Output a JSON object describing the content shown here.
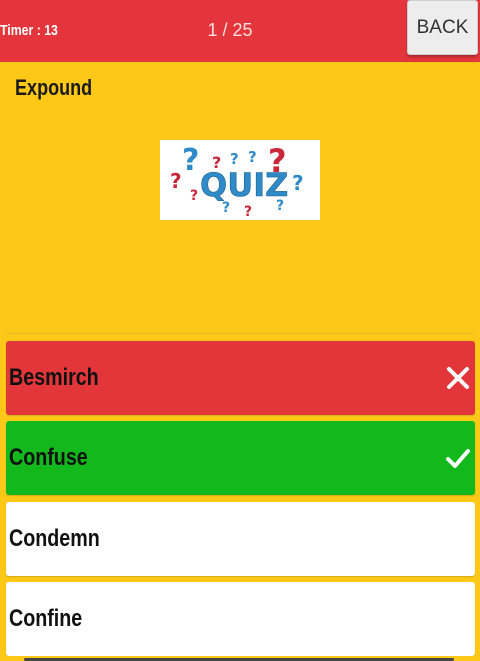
{
  "header": {
    "timer": "Timer  : 13",
    "progress": "1 / 25",
    "back_label": "BACK"
  },
  "question": {
    "word": "Expound",
    "image_text": "QUIZ"
  },
  "options": [
    {
      "label": "Besmirch",
      "state": "wrong",
      "icon": "close-icon"
    },
    {
      "label": "Confuse",
      "state": "correct",
      "icon": "check-icon"
    },
    {
      "label": "Condemn",
      "state": "neutral"
    },
    {
      "label": "Confine",
      "state": "neutral"
    }
  ],
  "colors": {
    "background": "#fdc817",
    "header": "#e3353b",
    "wrong": "#e2363b",
    "correct": "#13b81c",
    "neutral": "#ffffff"
  }
}
